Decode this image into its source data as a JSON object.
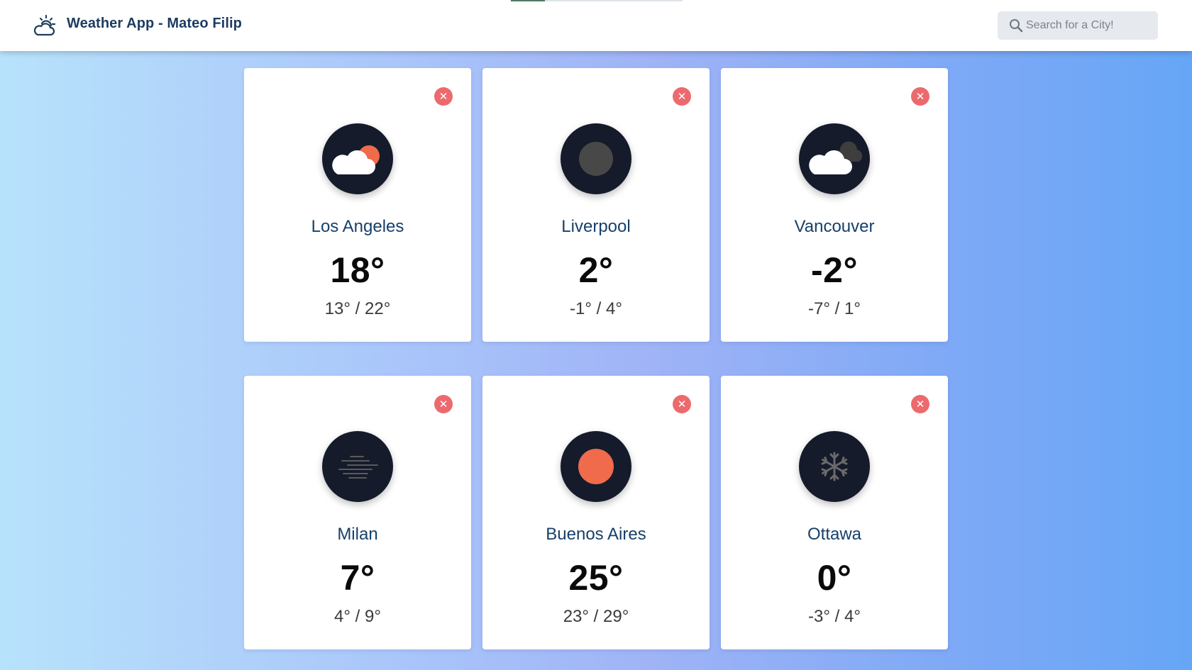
{
  "loading": {
    "progress": 0.2
  },
  "header": {
    "title": "Weather App - Mateo Filip",
    "icon": "partly-cloudy-icon",
    "search": {
      "placeholder": "Search for a City!",
      "value": ""
    }
  },
  "cards": [
    {
      "city": "Los Angeles",
      "temp": "18°",
      "range": "13° / 22°",
      "icon": "cloud-sun-icon",
      "remove_label": "✕"
    },
    {
      "city": "Liverpool",
      "temp": "2°",
      "range": "-1° / 4°",
      "icon": "moon-icon",
      "remove_label": "✕"
    },
    {
      "city": "Vancouver",
      "temp": "-2°",
      "range": "-7° / 1°",
      "icon": "cloud-moon-icon",
      "remove_label": "✕"
    },
    {
      "city": "Milan",
      "temp": "7°",
      "range": "4° / 9°",
      "icon": "fog-icon",
      "remove_label": "✕"
    },
    {
      "city": "Buenos Aires",
      "temp": "25°",
      "range": "23° / 29°",
      "icon": "sun-icon",
      "remove_label": "✕"
    },
    {
      "city": "Ottawa",
      "temp": "0°",
      "range": "-3° / 4°",
      "icon": "snowflake-icon",
      "remove_label": "✕"
    }
  ],
  "colors": {
    "remove": "#ec6a6e",
    "sun": "#ef6b4b",
    "icon_bg": "#151b2b",
    "city": "#17406a",
    "brand": "#1d3c5f"
  }
}
